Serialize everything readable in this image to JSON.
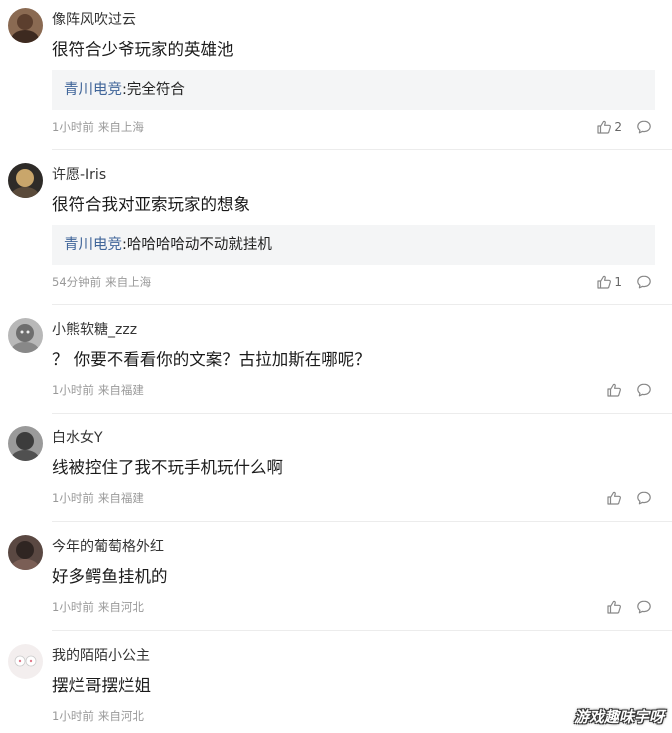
{
  "comments": [
    {
      "username": "像阵风吹过云",
      "content": "很符合少爷玩家的英雄池",
      "reply": {
        "author": "青川电竞",
        "sep": ":",
        "text": "完全符合"
      },
      "time": "1小时前",
      "location": "来自上海",
      "likes": "2",
      "avatar_color": "#6b4d3a"
    },
    {
      "username": "许愿-Iris",
      "content": "很符合我对亚索玩家的想象",
      "reply": {
        "author": "青川电竞",
        "sep": ":",
        "text": "哈哈哈哈动不动就挂机"
      },
      "time": "54分钟前",
      "location": "来自上海",
      "likes": "1",
      "avatar_color": "#3e3a34"
    },
    {
      "username": "小熊软糖_zzz",
      "content": "？ 你要不看看你的文案？古拉加斯在哪呢？",
      "time": "1小时前",
      "location": "来自福建",
      "avatar_color": "#8c8c8c"
    },
    {
      "username": "白水女Y",
      "content": "线被控住了我不玩手机玩什么啊",
      "time": "1小时前",
      "location": "来自福建",
      "avatar_color": "#555555"
    },
    {
      "username": "今年的葡萄格外红",
      "content": "好多鳄鱼挂机的",
      "time": "1小时前",
      "location": "来自河北",
      "avatar_color": "#4a3b36"
    },
    {
      "username": "我的陌陌小公主",
      "content": "摆烂哥摆烂姐",
      "time": "1小时前",
      "location": "来自河北",
      "avatar_color": "#e8e0e0"
    }
  ],
  "icons": {
    "like": "thumbs-up-icon",
    "comment": "comment-bubble-icon"
  },
  "watermark": "游戏趣味宇呀",
  "colors": {
    "reply_author": "#406599",
    "meta": "#999999",
    "reply_bg": "#f4f5f6"
  }
}
